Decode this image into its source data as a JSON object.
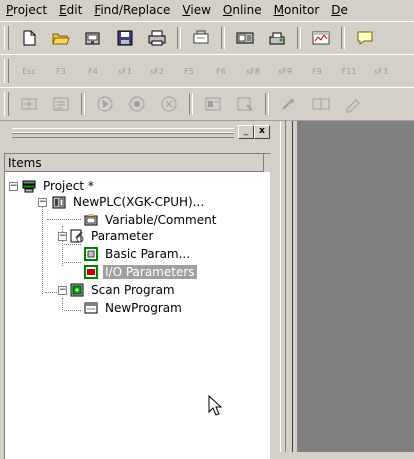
{
  "menu": {
    "items": [
      {
        "label": "Project",
        "u": "P"
      },
      {
        "label": "Edit",
        "u": "E"
      },
      {
        "label": "Find/Replace",
        "u": "F"
      },
      {
        "label": "View",
        "u": "V"
      },
      {
        "label": "Online",
        "u": "O"
      },
      {
        "label": "Monitor",
        "u": "M"
      },
      {
        "label": "De",
        "u": "D"
      }
    ]
  },
  "fkeys": [
    "Esc",
    "F3",
    "F4",
    "sF1",
    "sF2",
    "F5",
    "F6",
    "sF8",
    "sF9",
    "F9",
    "F11",
    "sF3"
  ],
  "panel": {
    "header": "Items",
    "minimize_glyph": "_",
    "close_glyph": "x"
  },
  "tree": {
    "project": "Project *",
    "plc": "NewPLC(XGK-CPUH)...",
    "variable": "Variable/Comment",
    "parameter": "Parameter",
    "basic": "Basic Param...",
    "io": "I/O Parameters",
    "scan": "Scan Program",
    "program": "NewProgram",
    "expand_minus": "−"
  }
}
